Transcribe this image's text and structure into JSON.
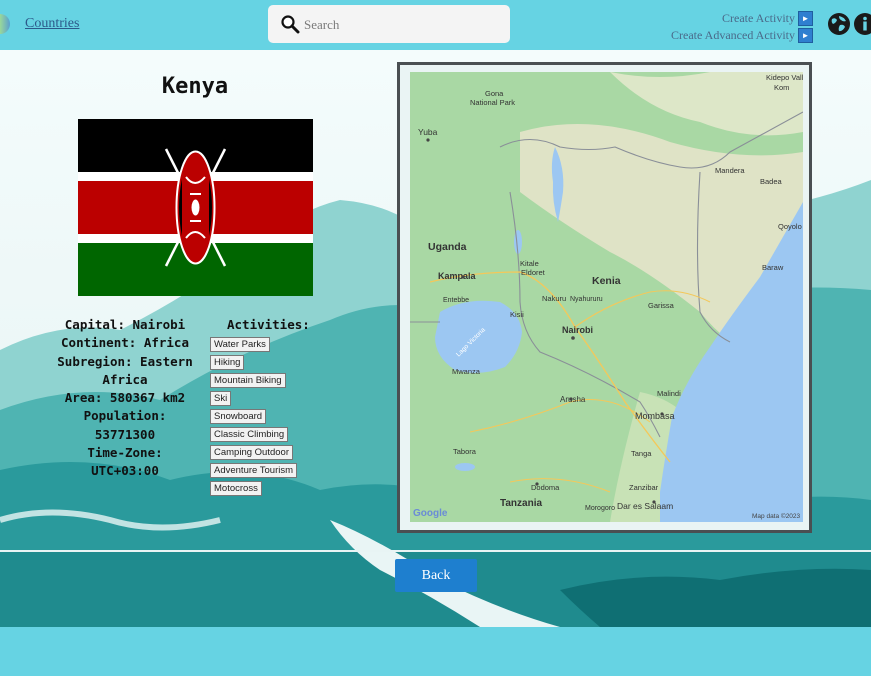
{
  "header": {
    "nav_link": "Countries",
    "search_placeholder": "Search",
    "create_activity": "Create Activity",
    "create_advanced_activity": "Create Advanced Activity"
  },
  "country": {
    "name": "Kenya",
    "info_lines": [
      "Capital: Nairobi",
      "Continent: Africa",
      "Subregion: Eastern",
      "Africa",
      "Area: 580367 km2",
      "Population:",
      "53771300",
      "Time-Zone:",
      "UTC+03:00"
    ]
  },
  "activities": {
    "title": "Activities:",
    "items": [
      "Water Parks",
      "Hiking",
      "Mountain Biking",
      "Ski",
      "Snowboard",
      "Classic Climbing",
      "Camping Outdoor",
      "Adventure Tourism",
      "Motocross"
    ]
  },
  "map": {
    "labels": {
      "kidepo": "Kidepo Valley",
      "kom": "Kom",
      "gona": "Gona",
      "national_park": "National Park",
      "yuba": "Yuba",
      "mandera": "Mandera",
      "badea": "Badea",
      "qoyolo": "Qoyolo",
      "uganda": "Uganda",
      "kitale": "Kitale",
      "eldoret": "Eldoret",
      "kampala": "Kampala",
      "entebbe": "Entebbe",
      "kenia": "Kenia",
      "nakuru": "Nakuru",
      "nyahururu": "Nyahururu",
      "garissa": "Garissa",
      "baraw": "Baraw",
      "lake_victoria": "Lago Victoria",
      "kisii": "Kisii",
      "nairobi": "Nairobi",
      "mwanza": "Mwanza",
      "arusha": "Arusha",
      "malindi": "Malindi",
      "mombasa": "Mombasa",
      "tabora": "Tabora",
      "tanga": "Tanga",
      "dodoma": "Dodoma",
      "zanzibar": "Zanzibar",
      "tanzania": "Tanzania",
      "dar": "Dar es Salaam",
      "morogoro": "Morogoro",
      "google": "Google",
      "attribution": "Map data ©2023"
    }
  },
  "back_label": "Back",
  "colors": {
    "page_bg": "#66d3e3",
    "button_blue": "#1e7fcf",
    "flag_black": "#000000",
    "flag_red": "#bb0000",
    "flag_green": "#006600"
  }
}
